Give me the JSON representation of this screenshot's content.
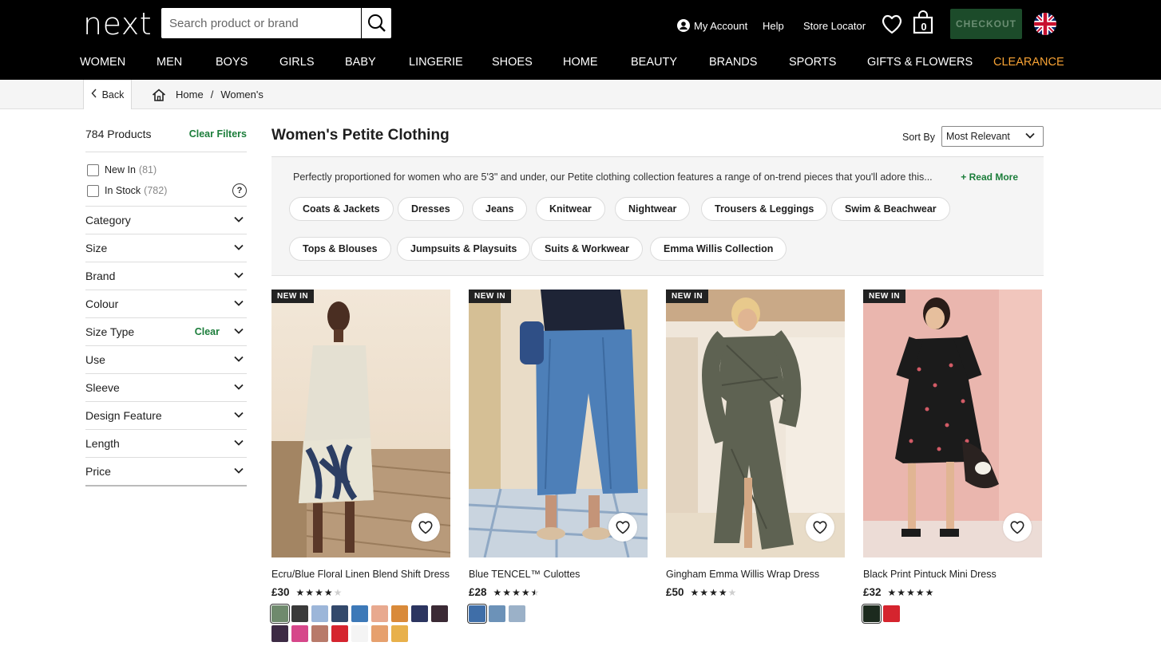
{
  "header": {
    "logo": "next",
    "search_placeholder": "Search product or brand",
    "my_account": "My Account",
    "help": "Help",
    "store_locator": "Store Locator",
    "bag_count": "0",
    "checkout": "CHECKOUT",
    "nav": [
      "WOMEN",
      "MEN",
      "BOYS",
      "GIRLS",
      "BABY",
      "LINGERIE",
      "SHOES",
      "HOME",
      "BEAUTY",
      "BRANDS",
      "SPORTS",
      "GIFTS & FLOWERS",
      "CLEARANCE"
    ],
    "clearance_color": "#f7a234"
  },
  "breadcrumb": {
    "back": "Back",
    "items": [
      "Home",
      "Women's"
    ],
    "separator": "/"
  },
  "sidebar": {
    "product_count": "784 Products",
    "clear_filters": "Clear Filters",
    "checkboxes": [
      {
        "label": "New In",
        "count": "(81)"
      },
      {
        "label": "In Stock",
        "count": "(782)"
      }
    ],
    "help_symbol": "?",
    "facets": [
      {
        "label": "Category"
      },
      {
        "label": "Size"
      },
      {
        "label": "Brand"
      },
      {
        "label": "Colour"
      },
      {
        "label": "Size Type",
        "clear": "Clear"
      },
      {
        "label": "Use"
      },
      {
        "label": "Sleeve"
      },
      {
        "label": "Design Feature"
      },
      {
        "label": "Length"
      },
      {
        "label": "Price"
      }
    ]
  },
  "content": {
    "title": "Women's Petite Clothing",
    "sort_label": "Sort By",
    "sort_value": "Most Relevant",
    "seo_text": "Perfectly proportioned for women who are 5'3\" and under, our Petite clothing collection features a range of on-trend pieces that you'll adore this...",
    "read_more": "+ Read More",
    "chips_row1": [
      "Coats & Jackets",
      "Dresses",
      "Jeans",
      "Knitwear",
      "Nightwear",
      "Trousers & Leggings",
      "Swim & Beachwear"
    ],
    "chips_row2": [
      "Tops & Blouses",
      "Jumpsuits & Playsuits",
      "Suits & Workwear",
      "Emma Willis Collection"
    ]
  },
  "products": [
    {
      "badge": "NEW IN",
      "title": "Ecru/Blue Floral Linen Blend Shift Dress",
      "price": "£30",
      "rating": 4,
      "swatches": [
        "#6f8a6d",
        "#3a3a3a",
        "#9cb6d9",
        "#33496b",
        "#3d79b8",
        "#e8a98f",
        "#d98a3a",
        "#2c3560",
        "#3b2a35",
        "#3d2a44",
        "#d6478a",
        "#b87a6a",
        "#d5242e",
        "#f4f4f4",
        "#e6a06e",
        "#e8b04a"
      ]
    },
    {
      "badge": "NEW IN",
      "title": "Blue TENCEL™ Culottes",
      "price": "£28",
      "rating": 4.5,
      "swatches": [
        "#3f6ea8",
        "#6c92b8",
        "#9bb1c8"
      ]
    },
    {
      "badge": "NEW IN",
      "title": "Gingham Emma Willis Wrap Dress",
      "price": "£50",
      "rating": 4,
      "swatches": []
    },
    {
      "badge": "NEW IN",
      "title": "Black Print Pintuck Mini Dress",
      "price": "£32",
      "rating": 5,
      "swatches": [
        "#1c2a1e",
        "#d5242e"
      ]
    }
  ],
  "colors": {
    "accent_green": "#1b7d3a",
    "checkout_bg": "#1c4b2a"
  }
}
